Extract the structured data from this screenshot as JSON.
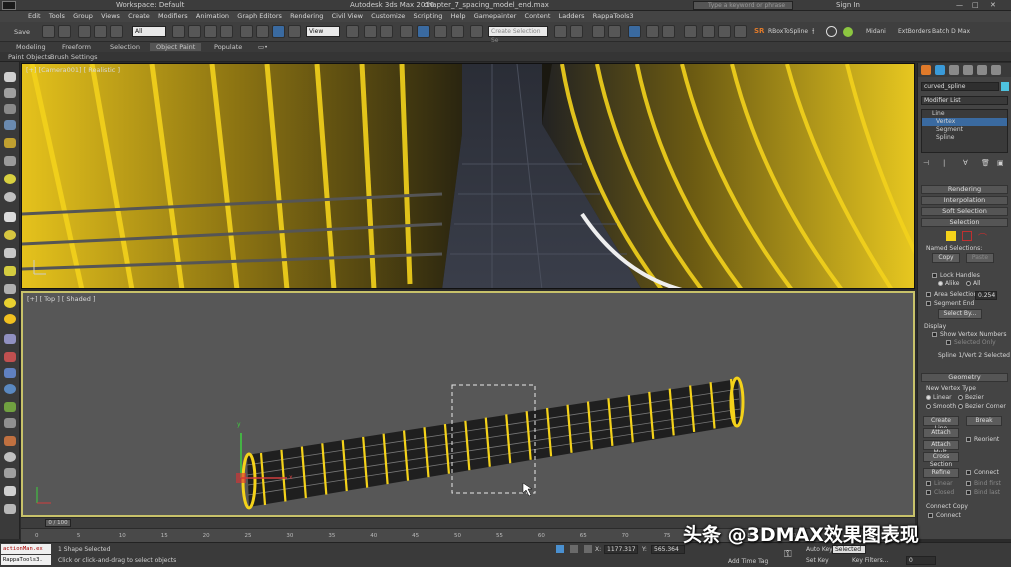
{
  "window": {
    "workspace": "Workspace: Default",
    "title": "Autodesk 3ds Max 2016",
    "file": "chapter_7_spacing_model_end.max",
    "search_placeholder": "Type a keyword or phrase",
    "sign_in": "Sign In"
  },
  "menu": [
    "Edit",
    "Tools",
    "Group",
    "Views",
    "Create",
    "Modifiers",
    "Animation",
    "Graph Editors",
    "Rendering",
    "Civil View",
    "Customize",
    "Scripting",
    "Help",
    "Gamepainter",
    "Content",
    "Ladders",
    "RappaTools3"
  ],
  "toolbar": {
    "save_label": "Save",
    "filter_value": "All",
    "refcoord_value": "View",
    "selset_placeholder": "Create Selection Se",
    "rbox_label": "RBoxToSpline",
    "midani_label": "Midani",
    "extborders_label": "ExtBorders",
    "batch_label": "Batch D Max"
  },
  "ribbon": {
    "tabs": [
      "Modeling",
      "Freeform",
      "Selection",
      "Object Paint",
      "Populate"
    ],
    "active_tab": "Object Paint",
    "sub": [
      "Paint Objects",
      "Brush Settings"
    ]
  },
  "viewports": {
    "top_label": "[+] [Camera001] [ Realistic ]",
    "bottom_label": "[+] [ Top ] [ Shaded ]",
    "axis_x": "x",
    "axis_y": "y"
  },
  "command_panel": {
    "object_name": "curved_spline",
    "modifier_list": "Modifier List",
    "stack": [
      "Line",
      "Vertex",
      "Segment",
      "Spline"
    ],
    "stack_selected": "Vertex",
    "rollouts": [
      "Rendering",
      "Interpolation",
      "Soft Selection",
      "Selection",
      "Geometry"
    ],
    "named_selections": "Named Selections:",
    "copy_btn": "Copy",
    "paste_btn": "Paste",
    "lock_handles": "Lock Handles",
    "alike": "Alike",
    "all": "All",
    "area_selection": "Area Selection:",
    "area_value": "0.254",
    "segment_end": "Segment End",
    "select_by": "Select By...",
    "display": "Display",
    "show_vertex_numbers": "Show Vertex Numbers",
    "selected_only": "Selected Only",
    "selection_status": "Spline 1/Vert 2 Selected",
    "new_vertex_type": "New Vertex Type",
    "linear": "Linear",
    "bezier": "Bezier",
    "smooth": "Smooth",
    "bezier_corner": "Bezier Corner",
    "create_line": "Create Line",
    "break": "Break",
    "attach": "Attach",
    "reorient": "Reorient",
    "attach_mult": "Attach Mult.",
    "cross_section": "Cross Section",
    "refine": "Refine",
    "connect": "Connect",
    "linear2": "Linear",
    "bind_first": "Bind first",
    "closed": "Closed",
    "bind_last": "Bind last",
    "connect_copy": "Connect Copy",
    "connect_chk": "Connect"
  },
  "timeline": {
    "frame_label": "0 / 100",
    "ticks": [
      "0",
      "5",
      "10",
      "15",
      "20",
      "25",
      "30",
      "35",
      "40",
      "45",
      "50",
      "55",
      "60",
      "65",
      "70",
      "75",
      "80",
      "85",
      "90",
      "95",
      "100"
    ]
  },
  "status": {
    "script_1": "actionMan.ex",
    "script_2": "RappaTools3.",
    "shapes_selected": "1 Shape Selected",
    "hint": "Click or click-and-drag to select objects",
    "x_label": "X:",
    "x_value": "1177.317",
    "y_label": "Y:",
    "y_value": "565.364",
    "auto_key": "Auto Key",
    "selected": "Selected",
    "set_key": "Set Key",
    "key_filters": "Key Filters...",
    "add_time_tag": "Add Time Tag",
    "frame_value": "0"
  },
  "watermark": "头条 @3DMAX效果图表现",
  "colors": {
    "accent_yellow": "#f4d21a",
    "viewport_border": "#c8c26a",
    "selected_blue": "#3a6aa0",
    "panel_bg": "#444444"
  }
}
